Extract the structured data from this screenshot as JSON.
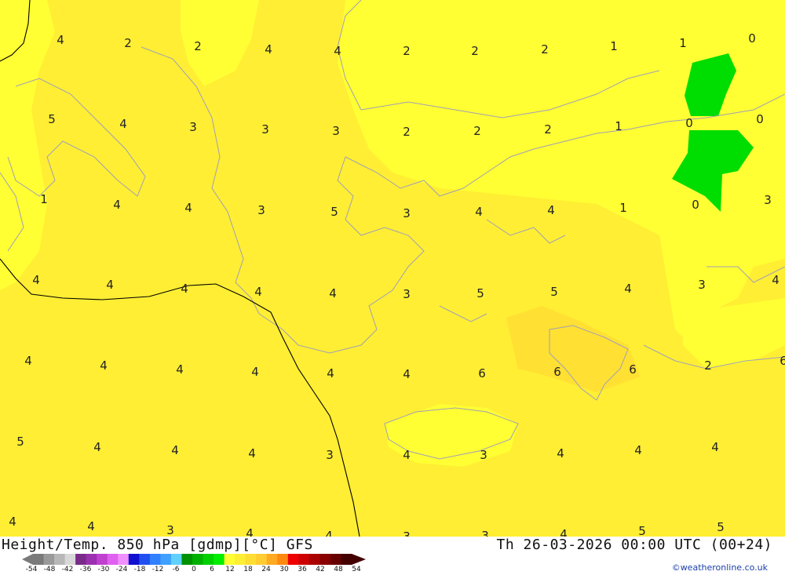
{
  "map": {
    "field_colors": {
      "yellow_light": "#ffff33",
      "yellow_mid": "#ffee33",
      "yellow_warm": "#ffe033",
      "green": "#00dd00"
    },
    "values": [
      "4",
      "2",
      "2",
      "4",
      "4",
      "2",
      "2",
      "2",
      "1",
      "1",
      "0",
      "5",
      "4",
      "3",
      "3",
      "3",
      "2",
      "2",
      "2",
      "1",
      "0",
      "0",
      "1",
      "4",
      "4",
      "3",
      "5",
      "3",
      "4",
      "4",
      "1",
      "0",
      "3",
      "4",
      "4",
      "4",
      "4",
      "4",
      "3",
      "5",
      "5",
      "4",
      "3",
      "4",
      "4",
      "4",
      "4",
      "4",
      "4",
      "4",
      "6",
      "6",
      "6",
      "2",
      "6",
      "5",
      "4",
      "4",
      "4",
      "3",
      "4",
      "3",
      "4",
      "4",
      "4",
      "4",
      "4",
      "3",
      "4",
      "4",
      "3",
      "3",
      "4",
      "5",
      "5"
    ]
  },
  "footer": {
    "title_left": "Height/Temp. 850 hPa [gdmp][°C] GFS",
    "title_right": "Th 26-03-2026 00:00 UTC (00+24)",
    "credit": "©weatheronline.co.uk",
    "legend_labels": [
      "-54",
      "-48",
      "-42",
      "-36",
      "-30",
      "-24",
      "-18",
      "-12",
      "-6",
      "0",
      "6",
      "12",
      "18",
      "24",
      "30",
      "36",
      "42",
      "48",
      "54"
    ],
    "legend_colors": [
      "#7a7a7a",
      "#9a9a9a",
      "#b8b8b8",
      "#d8d8d8",
      "#7a2a8a",
      "#9b30b0",
      "#c040d0",
      "#e060f0",
      "#f090ff",
      "#1010d0",
      "#2050f0",
      "#3080ff",
      "#40a0ff",
      "#60d0ff",
      "#009000",
      "#00b000",
      "#00d000",
      "#00ee00",
      "#ffff33",
      "#ffee33",
      "#ffdd33",
      "#ffcc33",
      "#ffaa22",
      "#ff8811",
      "#ee0000",
      "#cc0000",
      "#aa0000",
      "#880000",
      "#660000",
      "#440000"
    ]
  }
}
